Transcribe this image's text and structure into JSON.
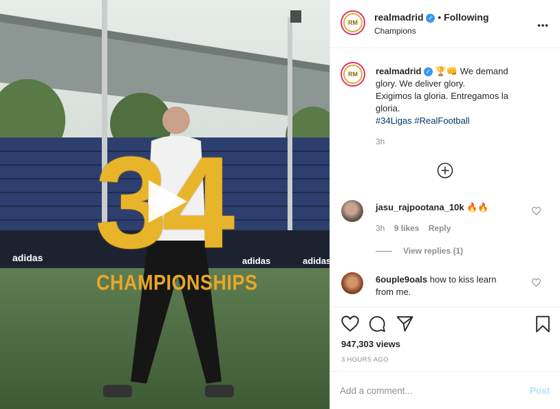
{
  "post": {
    "username": "realmadrid",
    "separator": "•",
    "follow_label": "Following",
    "location": "Champions",
    "more_icon": "more-dots-icon"
  },
  "caption": {
    "username": "realmadrid",
    "emoji_1": "🏆",
    "emoji_2": "👊",
    "line_1": "We demand",
    "line_2": "glory. We deliver glory.",
    "line_3": "Exigimos la gloria. Entregamos la",
    "line_4": "gloria.",
    "hashtag_1": "#34Ligas",
    "hashtag_2": "#RealFootball",
    "time": "3h"
  },
  "load_more_icon": "plus-circle-icon",
  "comments": [
    {
      "username": "jasu_rajpootana_10k",
      "text": "🔥🔥",
      "time": "3h",
      "likes": "9 likes",
      "reply_label": "Reply",
      "view_replies": "View replies (1)"
    },
    {
      "username": "6ouple9oals",
      "text_1": "how to kiss learn",
      "text_2": "from me."
    }
  ],
  "actions": {
    "like_icon": "heart-icon",
    "comment_icon": "comment-icon",
    "share_icon": "share-icon",
    "save_icon": "bookmark-icon"
  },
  "views": "947,303 views",
  "timestamp": "3 HOURS AGO",
  "add_comment": {
    "placeholder": "Add a comment...",
    "post_label": "Post"
  },
  "media": {
    "big_number": "34",
    "subtitle": "CHAMPIONSHIPS",
    "brand": "adidas",
    "play_icon": "play-icon"
  },
  "colors": {
    "link_blue": "#00376b",
    "verified_blue": "#3897f0",
    "post_disabled": "#b2dffc",
    "gold": "#e8b52a"
  }
}
